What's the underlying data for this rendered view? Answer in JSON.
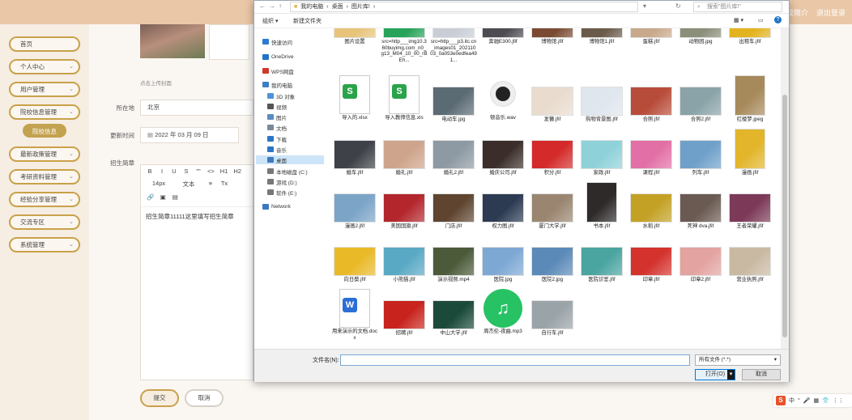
{
  "topbar": {
    "links": [
      "院校简介",
      "退出登录"
    ]
  },
  "sidebar": {
    "items": [
      {
        "label": "首页",
        "chevron": false
      },
      {
        "label": "个人中心",
        "chevron": true
      },
      {
        "label": "用户管理",
        "chevron": true
      },
      {
        "label": "院校信息管理",
        "chevron": true
      },
      {
        "label": "院校信息",
        "chevron": false,
        "sub": true
      },
      {
        "label": "最新政策管理",
        "chevron": true
      },
      {
        "label": "考研资料管理",
        "chevron": true
      },
      {
        "label": "经验分享管理",
        "chevron": true
      },
      {
        "label": "交流专区",
        "chevron": true
      },
      {
        "label": "系统管理",
        "chevron": true
      }
    ]
  },
  "form": {
    "upload_hint": "点击上传封面",
    "location_label": "所在地",
    "location_value": "北京",
    "update_time_label": "更新时间",
    "update_time_value": "2022 年 03 月 09 日",
    "guide_label": "招生简章",
    "editor_toolbar_row1": [
      "B",
      "I",
      "U",
      "S",
      "\"\"",
      "<>",
      "H1",
      "H2"
    ],
    "editor_toolbar_row2": [
      "14px",
      "文本",
      "≡",
      "Tx"
    ],
    "editor_content": "招生简章11111这里填写招生简章",
    "submit_label": "提交",
    "cancel_label": "取消"
  },
  "dialog": {
    "path": [
      "我的电脑",
      "桌面",
      "图片库!"
    ],
    "search_placeholder": "搜索\"图片库!\"",
    "cmd_organize": "组织 ▾",
    "cmd_new_folder": "新建文件夹",
    "nav": [
      {
        "label": "快速访问",
        "icon": "star-icon",
        "color": "#2a7ad1"
      },
      {
        "label": "OneDrive",
        "icon": "cloud-icon",
        "color": "#1e73c8"
      },
      {
        "label": "WPS网盘",
        "icon": "cloud-icon",
        "color": "#d0392b"
      },
      {
        "label": "我的电脑",
        "icon": "computer-icon",
        "color": "#3c7fc2"
      },
      {
        "label": "3D 对象",
        "icon": "cube-icon",
        "color": "#4f93d8"
      },
      {
        "label": "视频",
        "icon": "video-icon",
        "color": "#555555"
      },
      {
        "label": "图片",
        "icon": "picture-icon",
        "color": "#5a8bc0"
      },
      {
        "label": "文档",
        "icon": "document-icon",
        "color": "#7a8a99"
      },
      {
        "label": "下载",
        "icon": "download-icon",
        "color": "#2d74c4"
      },
      {
        "label": "音乐",
        "icon": "music-icon",
        "color": "#2d74c4"
      },
      {
        "label": "桌面",
        "icon": "desktop-icon",
        "color": "#3d7bc0",
        "selected": true
      },
      {
        "label": "本地磁盘 (C:)",
        "icon": "drive-icon",
        "color": "#777777"
      },
      {
        "label": "游戏 (D:)",
        "icon": "drive-icon",
        "color": "#777777"
      },
      {
        "label": "软件 (E:)",
        "icon": "drive-icon",
        "color": "#777777"
      },
      {
        "label": "Network",
        "icon": "network-icon",
        "color": "#3b78c4"
      }
    ],
    "files_row0": [
      {
        "name": "图片设置",
        "color": "#e8c47a"
      },
      {
        "name": "src=http___img10.360buyimg.com_n0_g13_M04_10_00_rBEh...",
        "color": "#27a35a"
      },
      {
        "name": "src=http___p3.itc.cn_images01_20211003_0a053e0edfea491...",
        "color": "#c9ced6"
      },
      {
        "name": "奔驰E300.jfif",
        "color": "#4c4c52"
      },
      {
        "name": "博物馆.jfif",
        "color": "#7a4b32"
      },
      {
        "name": "博物馆1.jfif",
        "color": "#6b5a4a"
      },
      {
        "name": "蛋糕.jfif",
        "color": "#c9a98b"
      },
      {
        "name": "动物园.jpg",
        "color": "#8a8f7a"
      },
      {
        "name": "出租车.jfif",
        "color": "#e3b21f"
      }
    ],
    "files": [
      {
        "name": "导入的.xlsx",
        "type": "xlsx"
      },
      {
        "name": "导入教师信息.xls",
        "type": "xlsx"
      },
      {
        "name": "电动车.jpg",
        "color": "#5b6b74"
      },
      {
        "name": "顿音乐.wav",
        "type": "wav"
      },
      {
        "name": "发簪.jfif",
        "color": "#e9dccf"
      },
      {
        "name": "购物背景图.jfif",
        "color": "#dfe6ee"
      },
      {
        "name": "合照.jfif",
        "color": "#b84c3a"
      },
      {
        "name": "合照2.jfif",
        "color": "#8aa3a8"
      },
      {
        "name": "红楼梦.jpeg",
        "color": "#a78a5b"
      },
      {
        "name": "婚车.jfif",
        "color": "#3e4147"
      },
      {
        "name": "婚礼.jfif",
        "color": "#cfa48c"
      },
      {
        "name": "婚礼2.jfif",
        "color": "#8e9aa3"
      },
      {
        "name": "婚庆公司.jfif",
        "color": "#3b2e2a"
      },
      {
        "name": "积分.jfif",
        "color": "#d42a2a"
      },
      {
        "name": "家政.jfif",
        "color": "#8fd1d9"
      },
      {
        "name": "课程.jfif",
        "color": "#e26fa5"
      },
      {
        "name": "列车.jfif",
        "color": "#6fa0c9"
      },
      {
        "name": "漫画.jfif",
        "color": "#e2b52b"
      },
      {
        "name": "漫画2.jfif",
        "color": "#7ba4c7"
      },
      {
        "name": "美国国旗.jfif",
        "color": "#b3262c"
      },
      {
        "name": "门店.jfif",
        "color": "#5f4530"
      },
      {
        "name": "权力图.jfif",
        "color": "#2c3a52"
      },
      {
        "name": "厦门大学.jfif",
        "color": "#9a8670"
      },
      {
        "name": "书本.jfif",
        "color": "#2e2a2a"
      },
      {
        "name": "水稻.jfif",
        "color": "#c3a125"
      },
      {
        "name": "死神 dva.jfif",
        "color": "#6a5a52"
      },
      {
        "name": "王者荣耀.jfif",
        "color": "#7c3a58"
      },
      {
        "name": "向日葵.jfif",
        "color": "#e9b928"
      },
      {
        "name": "小熊猫.jfif",
        "color": "#5aa9c4"
      },
      {
        "name": "演示视频.mp4",
        "color": "#4c5a3a"
      },
      {
        "name": "医院.jpg",
        "color": "#7ea8d4"
      },
      {
        "name": "医院2.jpg",
        "color": "#5b8ab8"
      },
      {
        "name": "医院诊室.jfif",
        "color": "#4aa4a0"
      },
      {
        "name": "印章.jfif",
        "color": "#d3322d"
      },
      {
        "name": "印章2.jfif",
        "color": "#e3a3a0"
      },
      {
        "name": "营业执照.jfif",
        "color": "#c9b9a2"
      },
      {
        "name": "用来演示的文档.docx",
        "type": "docx"
      },
      {
        "name": "招聘.jfif",
        "color": "#c8231d"
      },
      {
        "name": "中山大学.jfif",
        "color": "#1b4a3a"
      },
      {
        "name": "周杰伦-夜曲.mp3",
        "type": "mp3"
      },
      {
        "name": "自行车.jfif",
        "color": "#9aa3a8"
      }
    ],
    "filename_label": "文件名(N):",
    "filename_value": "",
    "filetype_value": "所有文件 (*.*)",
    "open_label": "打开(O)",
    "cancel_label": "取消"
  },
  "ime": {
    "items": [
      "中",
      "°",
      "🎤",
      "▦",
      "👕",
      "⋮⋮"
    ]
  }
}
